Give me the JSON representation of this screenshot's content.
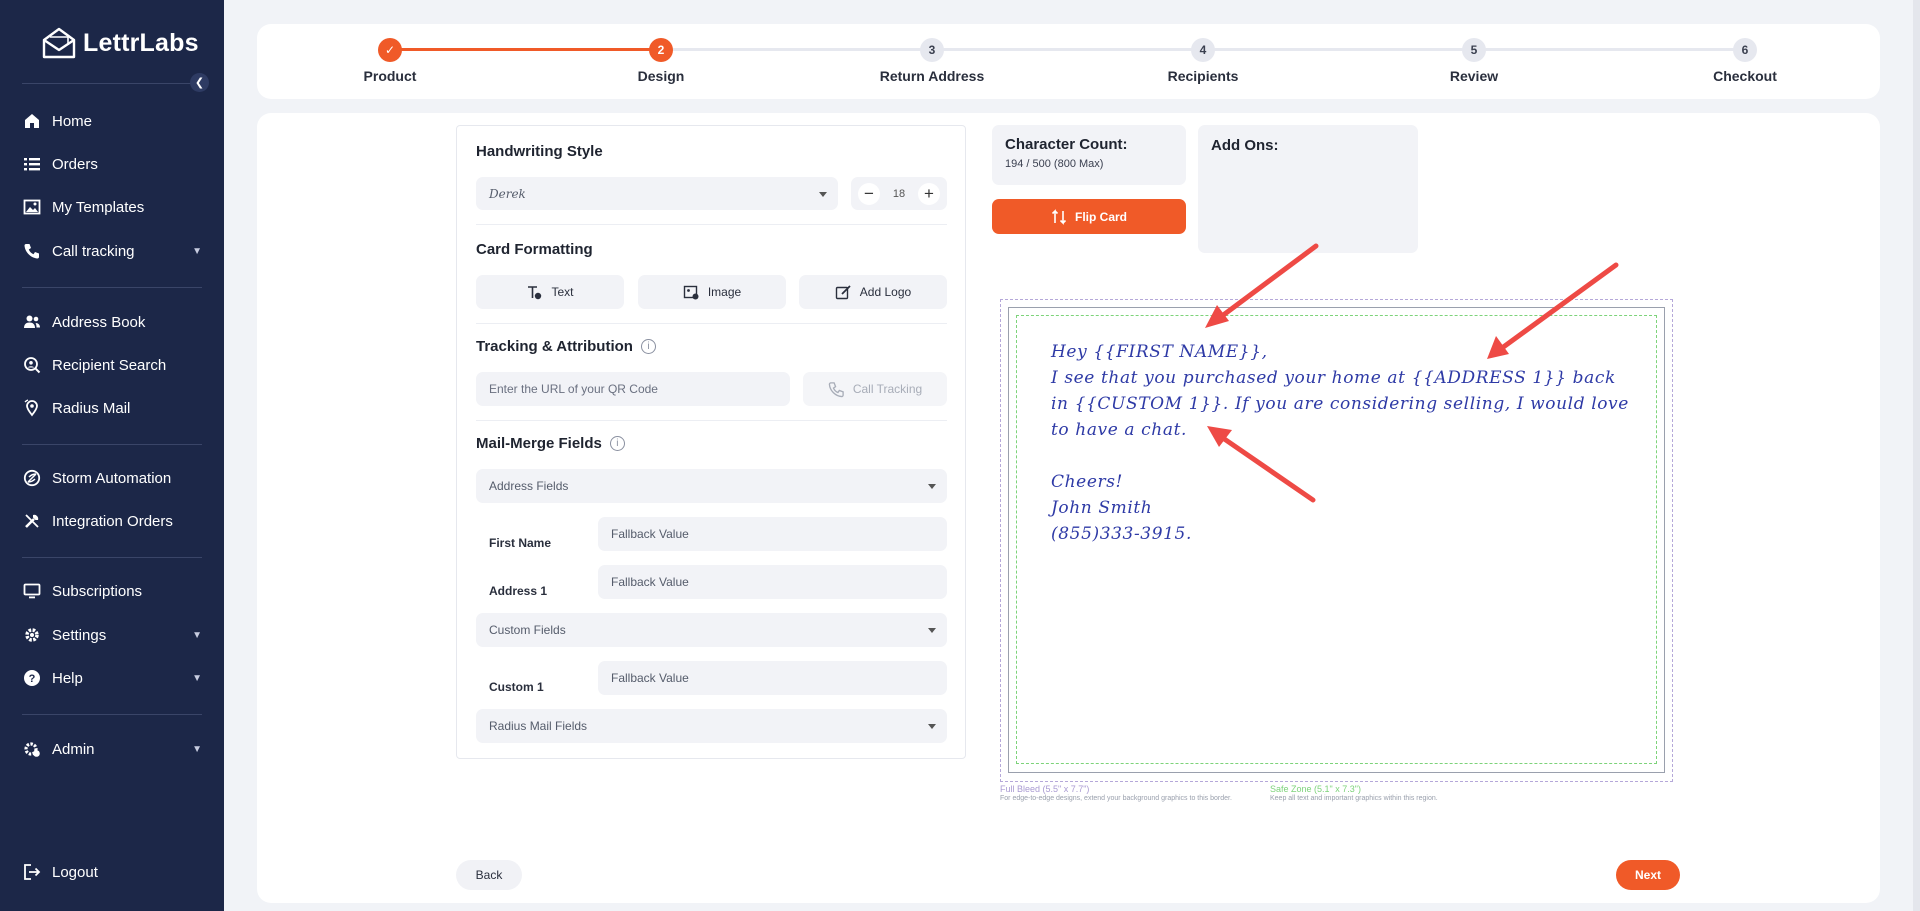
{
  "brand": {
    "name": "LettrLabs",
    "accent": "#f05a28",
    "sidebar_bg": "#1c2748"
  },
  "sidebar": {
    "items": [
      {
        "label": "Home",
        "icon": "home-icon"
      },
      {
        "label": "Orders",
        "icon": "list-icon"
      },
      {
        "label": "My Templates",
        "icon": "image-icon"
      },
      {
        "label": "Call tracking",
        "icon": "phone-icon",
        "expandable": true
      },
      {
        "label": "Address Book",
        "icon": "users-icon"
      },
      {
        "label": "Recipient Search",
        "icon": "search-person-icon"
      },
      {
        "label": "Radius Mail",
        "icon": "radius-icon"
      },
      {
        "label": "Storm Automation",
        "icon": "storm-icon"
      },
      {
        "label": "Integration Orders",
        "icon": "tools-icon"
      },
      {
        "label": "Subscriptions",
        "icon": "monitor-icon"
      },
      {
        "label": "Settings",
        "icon": "gear-icon",
        "expandable": true
      },
      {
        "label": "Help",
        "icon": "help-icon",
        "expandable": true
      },
      {
        "label": "Admin",
        "icon": "admin-gear-icon",
        "expandable": true
      },
      {
        "label": "Logout",
        "icon": "logout-icon"
      }
    ]
  },
  "stepper": {
    "steps": [
      {
        "number": "1",
        "label": "Product",
        "state": "done"
      },
      {
        "number": "2",
        "label": "Design",
        "state": "active"
      },
      {
        "number": "3",
        "label": "Return Address",
        "state": "todo"
      },
      {
        "number": "4",
        "label": "Recipients",
        "state": "todo"
      },
      {
        "number": "5",
        "label": "Review",
        "state": "todo"
      },
      {
        "number": "6",
        "label": "Checkout",
        "state": "todo"
      }
    ]
  },
  "design": {
    "handwriting": {
      "title": "Handwriting Style",
      "font": "Derek",
      "size": "18"
    },
    "formatting": {
      "title": "Card Formatting",
      "text_btn": "Text",
      "image_btn": "Image",
      "logo_btn": "Add Logo"
    },
    "tracking": {
      "title": "Tracking & Attribution",
      "qr_placeholder": "Enter the URL of your QR Code",
      "call_btn": "Call Tracking"
    },
    "mailmerge": {
      "title": "Mail-Merge Fields",
      "address_fields": "Address Fields",
      "first_name_label": "First Name",
      "address1_label": "Address 1",
      "custom_fields": "Custom Fields",
      "custom1_label": "Custom 1",
      "radius_fields": "Radius Mail Fields",
      "fallback": "Fallback Value"
    }
  },
  "count": {
    "title": "Character Count:",
    "value": "194 / 500 (800 Max)"
  },
  "flip": {
    "label": "Flip Card"
  },
  "addons": {
    "title": "Add Ons:"
  },
  "card": {
    "lines": [
      "Hey {{FIRST NAME}},",
      "I see that you purchased your home at {{ADDRESS 1}} back",
      "in {{CUSTOM 1}}. If you are considering selling, I would love",
      "to have a chat.",
      "",
      "Cheers!",
      "John Smith",
      "(855)333-3915."
    ],
    "full_bleed_title": "Full Bleed (5.5\" x 7.7\")",
    "full_bleed_desc": "For edge-to-edge designs, extend your background graphics to this border.",
    "safe_zone_title": "Safe Zone (5.1\" x 7.3\")",
    "safe_zone_desc": "Keep all text and important graphics within this region."
  },
  "nav": {
    "back": "Back",
    "next": "Next"
  }
}
